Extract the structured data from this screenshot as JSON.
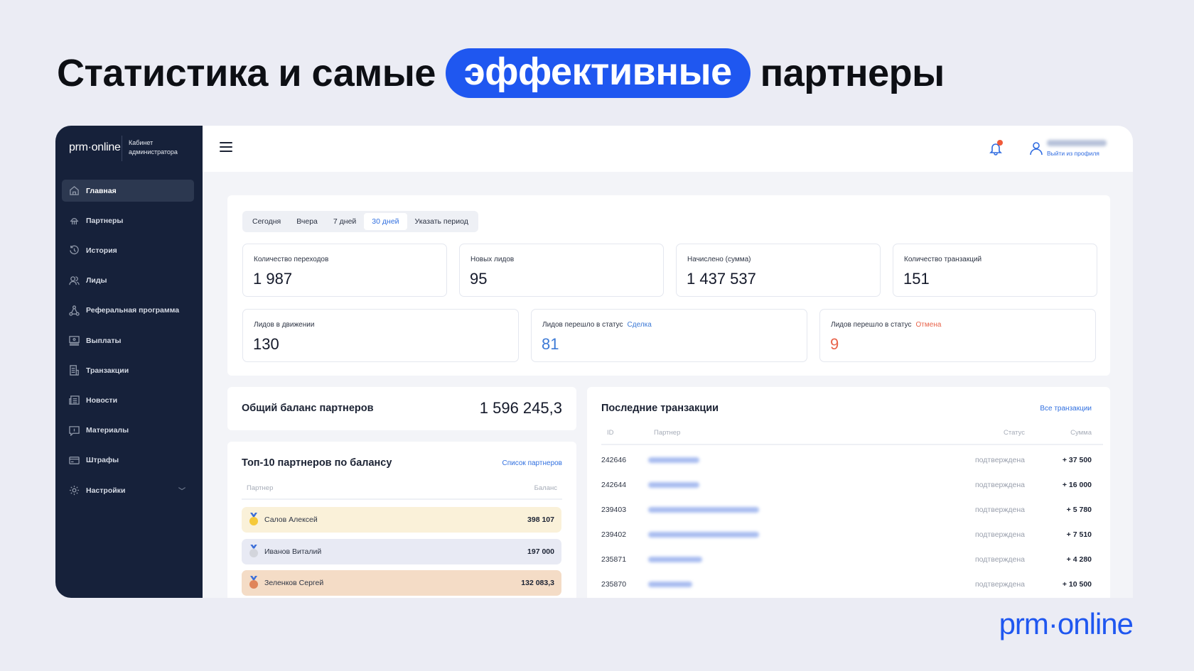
{
  "headline": {
    "before": "Статистика и самые",
    "highlight": "эффективные",
    "after": "партнеры"
  },
  "sidebar": {
    "logo": "prm·online",
    "cabinet": "Кабинет администратора",
    "items": [
      {
        "label": "Главная",
        "icon": "home-icon",
        "active": true
      },
      {
        "label": "Партнеры",
        "icon": "partners-icon"
      },
      {
        "label": "История",
        "icon": "history-icon"
      },
      {
        "label": "Лиды",
        "icon": "users-icon"
      },
      {
        "label": "Реферальная программа",
        "icon": "referral-icon"
      },
      {
        "label": "Выплаты",
        "icon": "payouts-icon"
      },
      {
        "label": "Транзакции",
        "icon": "receipt-icon"
      },
      {
        "label": "Новости",
        "icon": "news-icon"
      },
      {
        "label": "Материалы",
        "icon": "materials-icon"
      },
      {
        "label": "Штрафы",
        "icon": "card-icon"
      },
      {
        "label": "Настройки",
        "icon": "gear-icon",
        "expandable": true
      }
    ]
  },
  "header": {
    "logout": "Выйти из профиля",
    "language": "ru"
  },
  "period_tabs": [
    "Сегодня",
    "Вчера",
    "7 дней",
    "30 дней",
    "Указать период"
  ],
  "active_tab": "30 дней",
  "stats_row1": [
    {
      "label": "Количество переходов",
      "value": "1 987"
    },
    {
      "label": "Новых лидов",
      "value": "95"
    },
    {
      "label": "Начислено (сумма)",
      "value": "1 437 537"
    },
    {
      "label": "Количество транзакций",
      "value": "151"
    }
  ],
  "stats_row2": [
    {
      "label": "Лидов в движении",
      "value": "130"
    },
    {
      "label": "Лидов перешло в статус",
      "status": "Сделка",
      "value": "81"
    },
    {
      "label": "Лидов перешло в статус",
      "status": "Отмена",
      "value": "9"
    }
  ],
  "colors": {
    "accent": "#1f57f0",
    "deal": "#3d7ad6",
    "cancel": "#e8634a",
    "sidebar": "#16213a"
  },
  "balance": {
    "title": "Общий баланс партнеров",
    "value": "1 596 245,3"
  },
  "top10": {
    "title": "Топ-10 партнеров по балансу",
    "link": "Список партнеров",
    "col_partner": "Партнер",
    "col_balance": "Баланс",
    "rows": [
      {
        "name": "Салов Алексей",
        "balance": "398 107",
        "medal": "gold"
      },
      {
        "name": "Иванов Виталий",
        "balance": "197 000",
        "medal": "silver"
      },
      {
        "name": "Зеленков Сергей",
        "balance": "132 083,3",
        "medal": "bronze"
      }
    ]
  },
  "transactions": {
    "title": "Последние транзакции",
    "link": "Все транзакции",
    "cols": {
      "id": "ID",
      "partner": "Партнер",
      "status": "Статус",
      "sum": "Сумма"
    },
    "rows": [
      {
        "id": "242646",
        "status": "подтверждена",
        "sum": "+ 37 500"
      },
      {
        "id": "242644",
        "status": "подтверждена",
        "sum": "+ 16 000"
      },
      {
        "id": "239403",
        "status": "подтверждена",
        "sum": "+ 5 780"
      },
      {
        "id": "239402",
        "status": "подтверждена",
        "sum": "+ 7 510"
      },
      {
        "id": "235871",
        "status": "подтверждена",
        "sum": "+ 4 280"
      },
      {
        "id": "235870",
        "status": "подтверждена",
        "sum": "+ 10 500"
      }
    ]
  },
  "footer_logo": "prm·online"
}
